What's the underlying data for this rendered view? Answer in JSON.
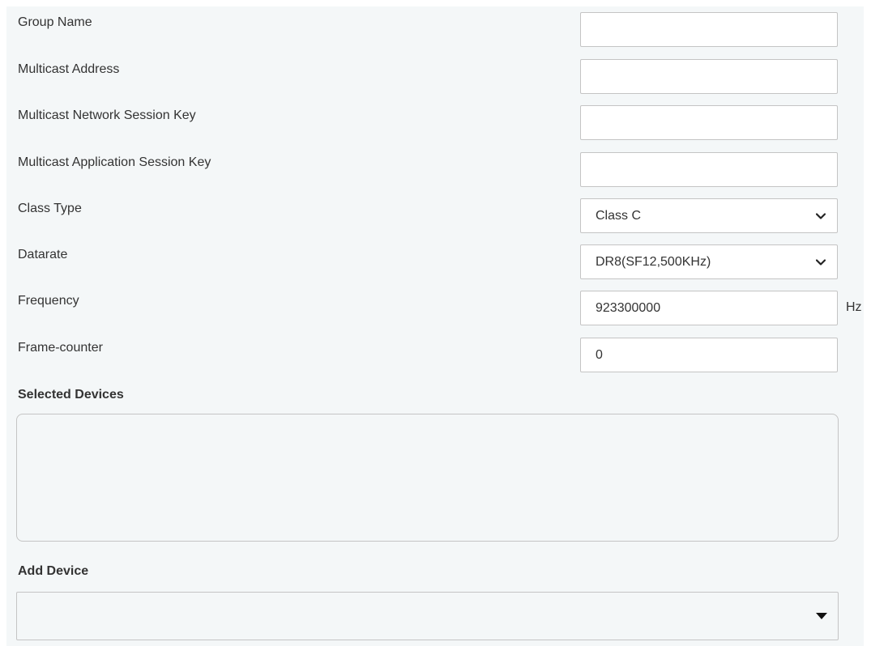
{
  "form": {
    "group_name": {
      "label": "Group Name",
      "value": ""
    },
    "multicast_address": {
      "label": "Multicast Address",
      "value": ""
    },
    "network_session_key": {
      "label": "Multicast Network Session Key",
      "value": ""
    },
    "application_session_key": {
      "label": "Multicast Application Session Key",
      "value": ""
    },
    "class_type": {
      "label": "Class Type",
      "selected": "Class C",
      "icon": "chevron-down-icon"
    },
    "datarate": {
      "label": "Datarate",
      "selected": "DR8(SF12,500KHz)",
      "icon": "chevron-down-icon"
    },
    "frequency": {
      "label": "Frequency",
      "value": "923300000",
      "unit": "Hz"
    },
    "frame_counter": {
      "label": "Frame-counter",
      "value": "0"
    }
  },
  "selected_devices": {
    "title": "Selected Devices",
    "value": ""
  },
  "add_device": {
    "title": "Add Device",
    "selected": "",
    "icon": "caret-down-icon"
  },
  "colors": {
    "panel_background": "#f4f7f8",
    "border": "#c4c4c4",
    "text": "#333333"
  }
}
